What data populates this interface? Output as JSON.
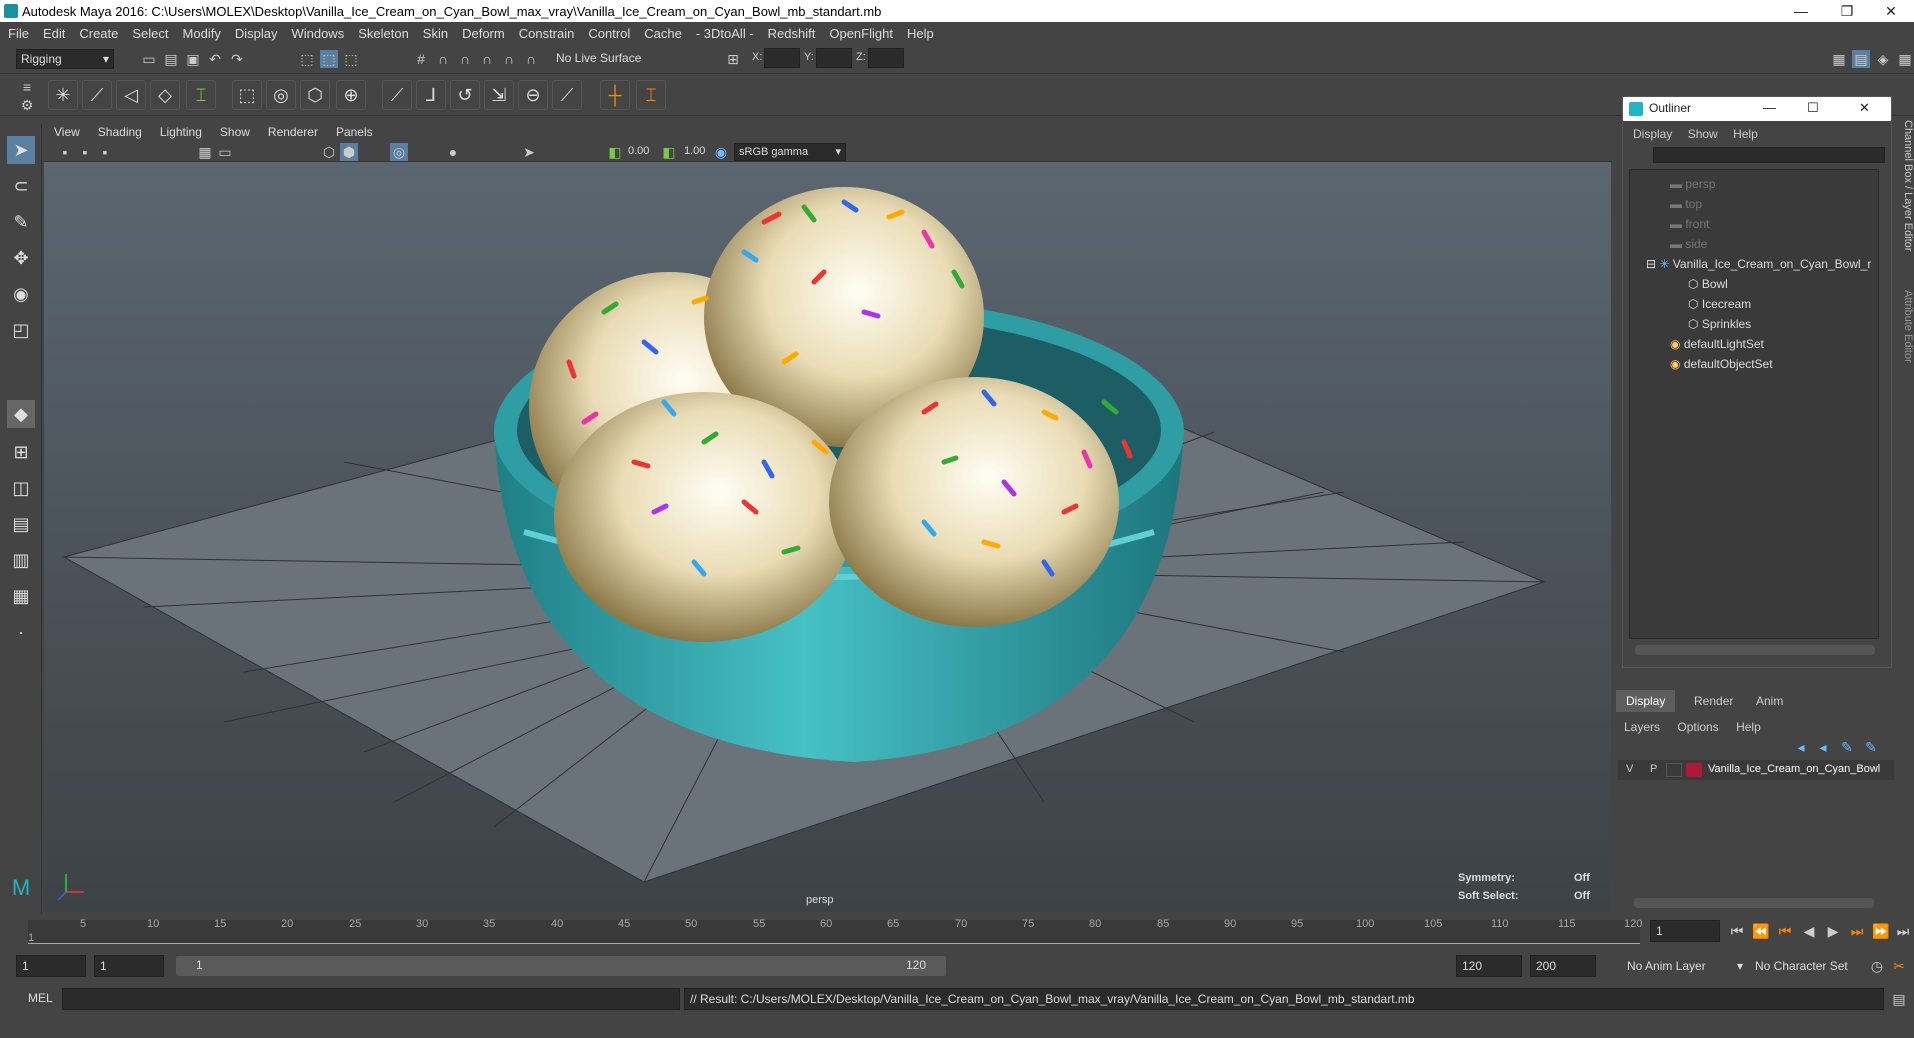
{
  "title": "Autodesk Maya 2016: C:\\Users\\MOLEX\\Desktop\\Vanilla_Ice_Cream_on_Cyan_Bowl_max_vray\\Vanilla_Ice_Cream_on_Cyan_Bowl_mb_standart.mb",
  "menu": [
    "File",
    "Edit",
    "Create",
    "Select",
    "Modify",
    "Display",
    "Windows",
    "Skeleton",
    "Skin",
    "Deform",
    "Constrain",
    "Control",
    "Cache",
    "- 3DtoAll -",
    "Redshift",
    "OpenFlight",
    "Help"
  ],
  "status": {
    "mode": "Rigging",
    "live_surface": "No Live Surface",
    "x": "X:",
    "y": "Y:",
    "z": "Z:"
  },
  "viewport_menu": [
    "View",
    "Shading",
    "Lighting",
    "Show",
    "Renderer",
    "Panels"
  ],
  "viewport_tool": {
    "exposure": "0.00",
    "gamma": "1.00",
    "color_space": "sRGB gamma"
  },
  "viewport": {
    "camera": "persp",
    "symmetry_label": "Symmetry:",
    "symmetry_value": "Off",
    "soft_select_label": "Soft Select:",
    "soft_select_value": "Off"
  },
  "outliner": {
    "title": "Outliner",
    "menu": [
      "Display",
      "Show",
      "Help"
    ],
    "items": [
      "persp",
      "top",
      "front",
      "side",
      "Vanilla_Ice_Cream_on_Cyan_Bowl_r",
      "Bowl",
      "Icecream",
      "Sprinkles",
      "defaultLightSet",
      "defaultObjectSet"
    ]
  },
  "channel": {
    "tabs": [
      "Display",
      "Render",
      "Anim"
    ],
    "menu": [
      "Layers",
      "Options",
      "Help"
    ],
    "layer": {
      "v": "V",
      "p": "P",
      "name": "Vanilla_Ice_Cream_on_Cyan_Bowl",
      "color": "#b0183a"
    },
    "side_tabs": [
      "Channel Box / Layer Editor",
      "Attribute Editor"
    ]
  },
  "timeline": {
    "ticks": [
      "5",
      "10",
      "15",
      "20",
      "25",
      "30",
      "35",
      "40",
      "45",
      "50",
      "55",
      "60",
      "65",
      "70",
      "75",
      "80",
      "85",
      "90",
      "95",
      "100",
      "105",
      "110",
      "115",
      "120"
    ],
    "start_marker": "1",
    "current_frame": "1"
  },
  "range": {
    "start": "1",
    "start2": "1",
    "slider_start": "1",
    "slider_end": "120",
    "end": "120",
    "end2": "200",
    "anim_layer": "No Anim Layer",
    "char_set": "No Character Set"
  },
  "cmd": {
    "lang": "MEL",
    "result": "// Result: C:/Users/MOLEX/Desktop/Vanilla_Ice_Cream_on_Cyan_Bowl_max_vray/Vanilla_Ice_Cream_on_Cyan_Bowl_mb_standart.mb"
  },
  "colors": {
    "bowl": "#3fb3b8",
    "icecream": "#e9dcb5",
    "accent": "#5a9fd4"
  }
}
